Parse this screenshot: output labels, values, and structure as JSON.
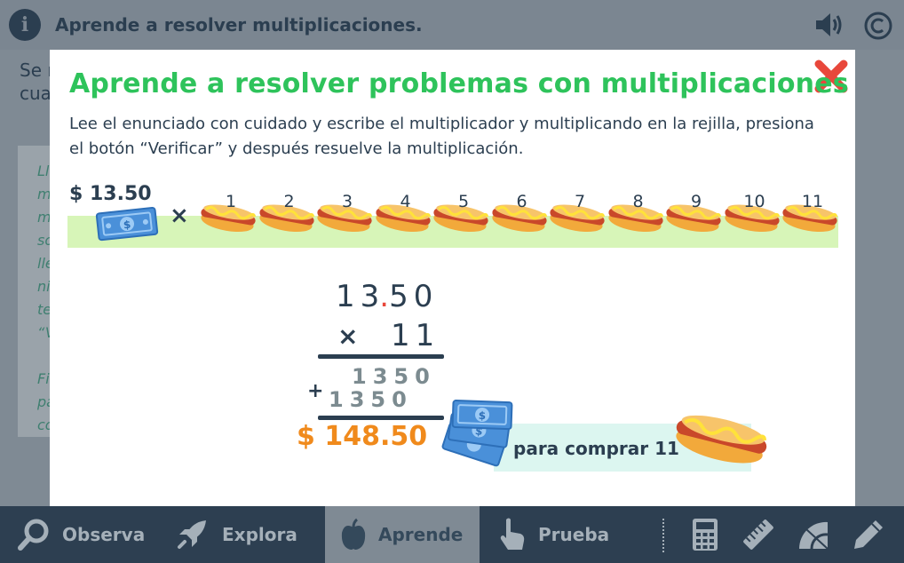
{
  "topbar": {
    "title": "Aprende a resolver multiplicaciones.",
    "icons": [
      "info-icon",
      "speaker-icon",
      "copyright-icon"
    ]
  },
  "background": {
    "text_line1": "Se r",
    "text_line2": "cua",
    "panel_lines": [
      "Ll",
      "m",
      "m",
      "so",
      "lle",
      "ni",
      "te",
      "“V",
      "",
      "Fi",
      "pa",
      "co"
    ]
  },
  "modal": {
    "title": "Aprende a resolver problemas con multiplicaciones",
    "description": "Lee el enunciado con cuidado y escribe el multiplicador y multiplicando en la rejilla, presiona el botón “Verificar” y después resuelve la multiplicación.",
    "price_label": "$ 13.50",
    "times_symbol": "×",
    "hotdog_numbers": [
      "1",
      "2",
      "3",
      "4",
      "5",
      "6",
      "7",
      "8",
      "9",
      "10",
      "11"
    ],
    "multiplication": {
      "multiplicand_a": "13",
      "decimal_point": ".",
      "multiplicand_b": "50",
      "times_symbol": "×",
      "multiplier": "11",
      "partial_1": "1350",
      "plus_symbol": "+",
      "partial_2": "1350",
      "result": "$ 148.50",
      "result_caption": "para comprar 11"
    }
  },
  "nav": {
    "items": [
      {
        "label": "Observa",
        "icon": "search-icon"
      },
      {
        "label": "Explora",
        "icon": "rocket-icon"
      },
      {
        "label": "Aprende",
        "icon": "apple-icon",
        "active": true
      },
      {
        "label": "Prueba",
        "icon": "hand-pointer-icon"
      }
    ],
    "tools": [
      "calculator-icon",
      "ruler-icon",
      "protractor-icon",
      "pencil-icon"
    ]
  },
  "colors": {
    "title_green": "#2ec35b",
    "result_orange": "#f08a1c",
    "close_red": "#e8473b",
    "navy": "#2b3e50",
    "strip_green": "#d7f5b8",
    "strip_teal": "#dcf6f0"
  }
}
